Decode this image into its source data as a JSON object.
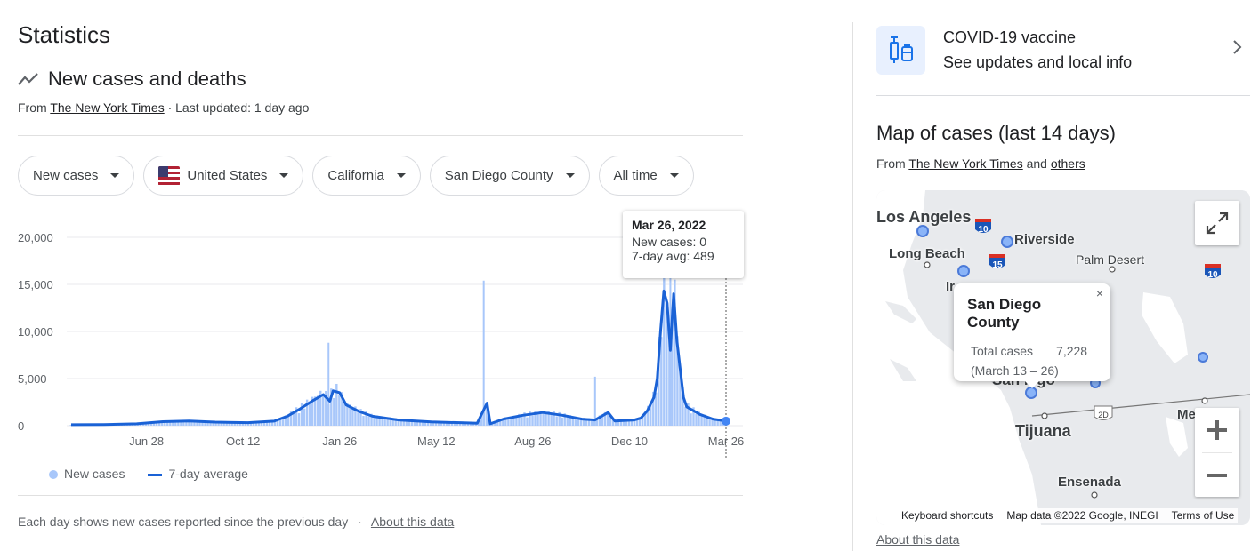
{
  "statistics_title": "Statistics",
  "section_title": "New cases and deaths",
  "source": {
    "prefix": "From",
    "link": "The New York Times",
    "updated": "· Last updated: 1 day ago"
  },
  "chips": {
    "metric": "New cases",
    "country": "United States",
    "state": "California",
    "county": "San Diego County",
    "range": "All time"
  },
  "tooltip": {
    "date": "Mar 26, 2022",
    "new_cases": "New cases: 0",
    "avg": "7-day avg: 489"
  },
  "legend": {
    "bars": "New cases",
    "line": "7-day average"
  },
  "footnote": {
    "text": "Each day shows new cases reported since the previous day",
    "sep": "·",
    "link": "About this data"
  },
  "chart_data": {
    "type": "bar",
    "title": "",
    "ylim": [
      0,
      20000
    ],
    "y_ticks": [
      "20,000",
      "15,000",
      "10,000",
      "5,000",
      "0"
    ],
    "y_tick_values": [
      20000,
      15000,
      10000,
      5000,
      0
    ],
    "x_ticks": [
      "Jun 28",
      "Oct 12",
      "Jan 26",
      "May 12",
      "Aug 26",
      "Dec 10",
      "Mar 26"
    ],
    "series": [
      {
        "name": "New cases",
        "kind": "bar",
        "color": "#a8c7fa"
      },
      {
        "name": "7-day average",
        "kind": "line",
        "color": "#1a62d6"
      }
    ],
    "spikes": [
      {
        "x": 0.393,
        "value": 8800
      },
      {
        "x": 0.63,
        "value": 15400
      },
      {
        "x": 0.8,
        "value": 5200
      },
      {
        "x": 0.915,
        "value": 16500
      },
      {
        "x": 0.922,
        "value": 15500
      }
    ],
    "weekly_avg": [
      [
        0,
        100
      ],
      [
        0.05,
        120
      ],
      [
        0.1,
        200
      ],
      [
        0.14,
        420
      ],
      [
        0.18,
        500
      ],
      [
        0.22,
        380
      ],
      [
        0.27,
        320
      ],
      [
        0.31,
        480
      ],
      [
        0.33,
        1000
      ],
      [
        0.35,
        1800
      ],
      [
        0.37,
        2700
      ],
      [
        0.385,
        3300
      ],
      [
        0.395,
        2600
      ],
      [
        0.4,
        3700
      ],
      [
        0.41,
        3500
      ],
      [
        0.42,
        2200
      ],
      [
        0.44,
        1500
      ],
      [
        0.46,
        1000
      ],
      [
        0.5,
        600
      ],
      [
        0.55,
        400
      ],
      [
        0.6,
        300
      ],
      [
        0.62,
        250
      ],
      [
        0.635,
        2400
      ],
      [
        0.64,
        200
      ],
      [
        0.66,
        700
      ],
      [
        0.69,
        1100
      ],
      [
        0.72,
        1400
      ],
      [
        0.75,
        1100
      ],
      [
        0.78,
        700
      ],
      [
        0.8,
        600
      ],
      [
        0.82,
        1400
      ],
      [
        0.83,
        500
      ],
      [
        0.86,
        600
      ],
      [
        0.87,
        800
      ],
      [
        0.88,
        1600
      ],
      [
        0.89,
        3000
      ],
      [
        0.895,
        5000
      ],
      [
        0.9,
        10000
      ],
      [
        0.905,
        14300
      ],
      [
        0.91,
        13000
      ],
      [
        0.915,
        8000
      ],
      [
        0.92,
        14000
      ],
      [
        0.925,
        9000
      ],
      [
        0.93,
        6000
      ],
      [
        0.935,
        3000
      ],
      [
        0.94,
        2000
      ],
      [
        0.96,
        1200
      ],
      [
        0.98,
        700
      ],
      [
        1.0,
        489
      ]
    ]
  },
  "vaccine": {
    "title": "COVID-19 vaccine",
    "subtitle": "See updates and local info"
  },
  "map": {
    "title": "Map of cases (last 14 days)",
    "source_prefix": "From",
    "source_link1": "The New York Times",
    "source_and": "and",
    "source_link2": "others",
    "labels": {
      "los_angeles": "Los Angeles",
      "riverside": "Riverside",
      "long_beach": "Long Beach",
      "palm_desert": "Palm Desert",
      "irvine": "Ir",
      "tijuana": "Tijuana",
      "ensenada": "Ensenada",
      "mexicali": "Me",
      "sd_partial": "San  iego"
    },
    "highway_labels": [
      "10",
      "15",
      "10",
      "2D"
    ],
    "popup": {
      "title": "San Diego County",
      "total_label": "Total cases",
      "total_value": "7,228",
      "range": "(March 13 – 26)",
      "close": "×"
    },
    "attribution": [
      "Keyboard shortcuts",
      "Map data ©2022 Google, INEGI",
      "Terms of Use"
    ],
    "about": "About this data"
  }
}
